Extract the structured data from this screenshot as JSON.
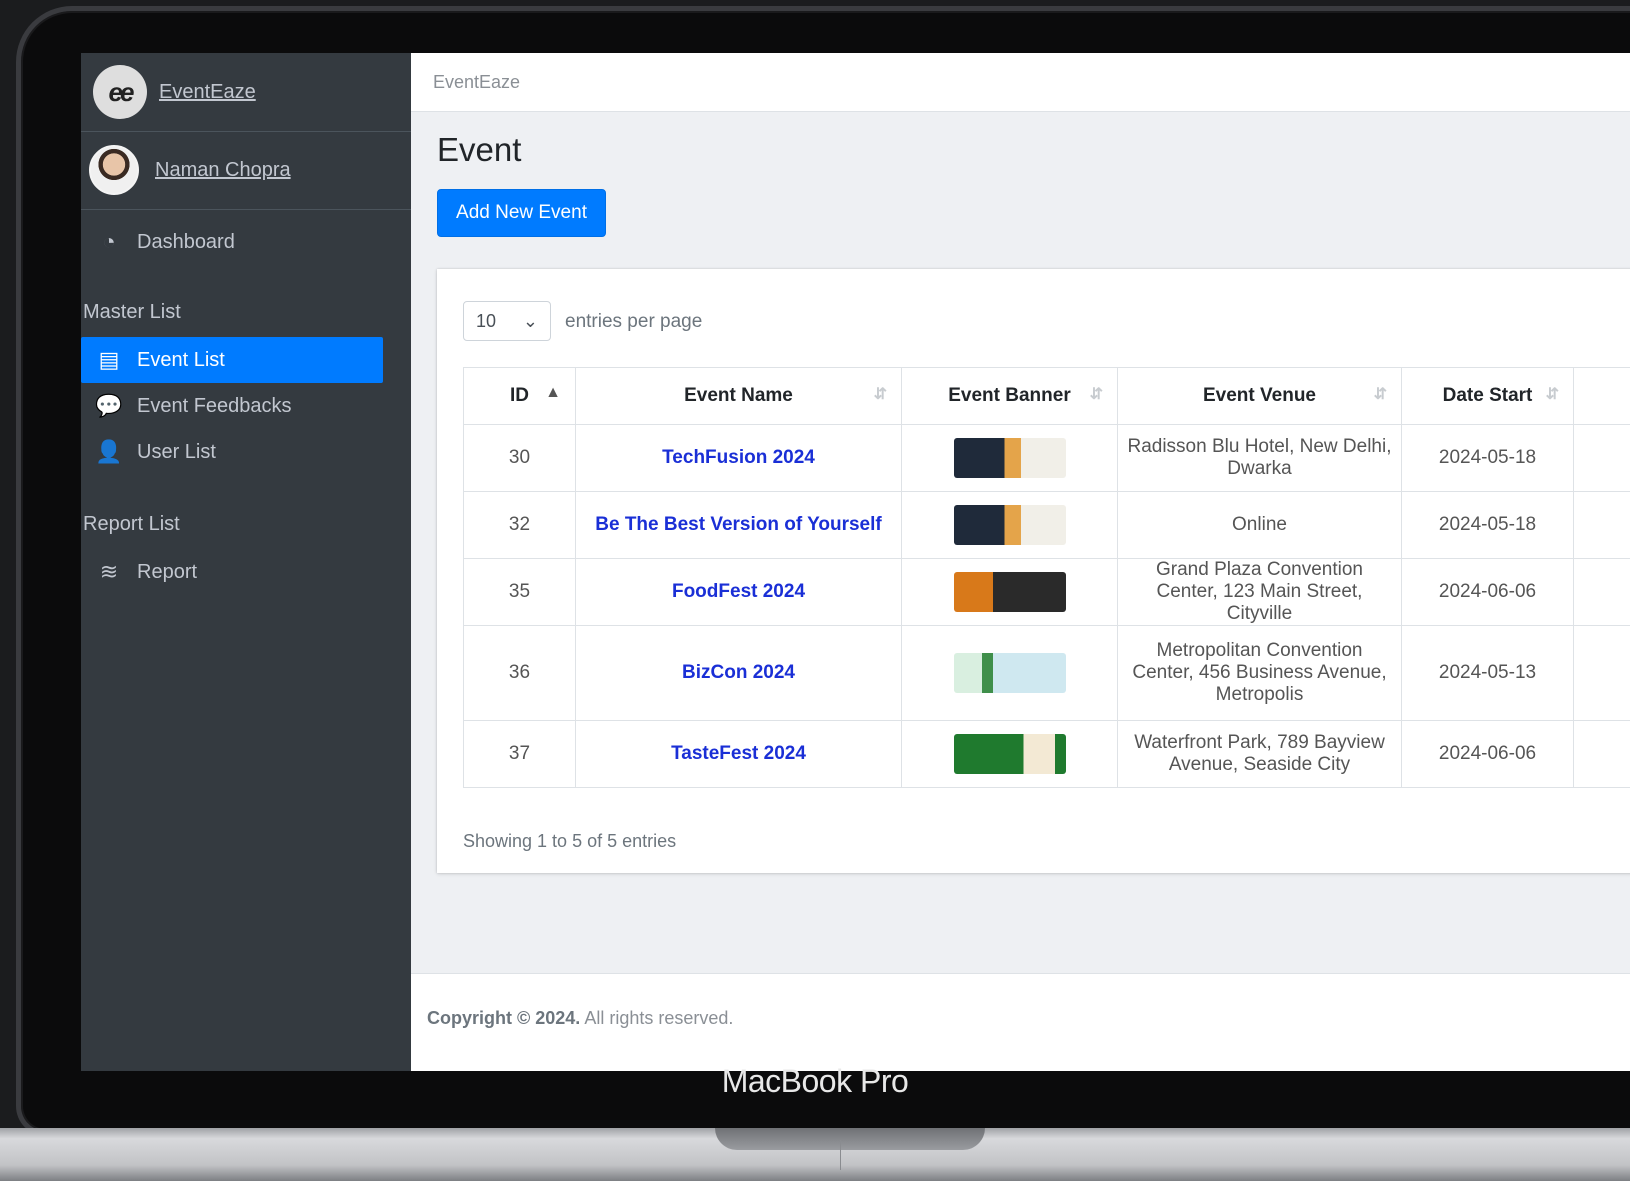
{
  "device": {
    "label": "MacBook Pro"
  },
  "sidebar": {
    "brand": "EventEaze",
    "logo_text": "ee",
    "user": "Naman Chopra",
    "items": [
      {
        "label": "Dashboard",
        "icon": "dashboard-icon"
      },
      {
        "label": "Event List",
        "icon": "table-icon",
        "active": true
      },
      {
        "label": "Event Feedbacks",
        "icon": "comments-icon"
      },
      {
        "label": "User List",
        "icon": "user-icon"
      },
      {
        "label": "Report",
        "icon": "database-icon"
      }
    ],
    "headers": [
      "Master List",
      "Report List"
    ]
  },
  "topbar": {
    "brand": "EventEaze"
  },
  "page": {
    "title": "Event",
    "add_button": "Add New Event"
  },
  "table": {
    "length_value": "10",
    "length_label": "entries per page",
    "columns": [
      "ID",
      "Event Name",
      "Event Banner",
      "Event Venue",
      "Date Start"
    ],
    "rows": [
      {
        "id": "30",
        "name": "TechFusion 2024",
        "venue": "Radisson Blu Hotel, New Delhi, Dwarka",
        "date": "2024-05-18"
      },
      {
        "id": "32",
        "name": "Be The Best Version of Yourself",
        "venue": "Online",
        "date": "2024-05-18"
      },
      {
        "id": "35",
        "name": "FoodFest 2024",
        "venue": "Grand Plaza Convention Center, 123 Main Street, Cityville",
        "date": "2024-06-06"
      },
      {
        "id": "36",
        "name": "BizCon 2024",
        "venue": "Metropolitan Convention Center, 456 Business Avenue, Metropolis",
        "date": "2024-05-13"
      },
      {
        "id": "37",
        "name": "TasteFest 2024",
        "venue": "Waterfront Park, 789 Bayview Avenue, Seaside City",
        "date": "2024-06-06"
      }
    ],
    "info": "Showing 1 to 5 of 5 entries"
  },
  "footer": {
    "copyright": "Copyright © 2024.",
    "rights": "All rights reserved."
  }
}
